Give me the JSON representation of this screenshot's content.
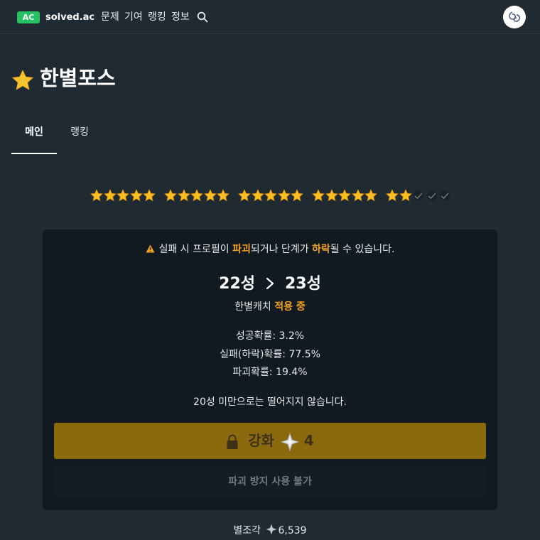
{
  "nav": {
    "badge": "AC",
    "brand": "solved.ac",
    "items": [
      "문제",
      "기여",
      "랭킹",
      "정보"
    ]
  },
  "page": {
    "title": "한별포스"
  },
  "tabs": [
    "메인",
    "랭킹"
  ],
  "stars": {
    "groups": 5,
    "per_group": 5,
    "filled": 22,
    "total": 25,
    "color": "#fbbf24"
  },
  "card": {
    "warning": {
      "pre": "실패 시 프로필이 ",
      "hl1": "파괴",
      "mid": "되거나 단계가 ",
      "hl2": "하락",
      "post": "될 수 있습니다."
    },
    "level_from": "22성",
    "level_to": "23성",
    "catch_label": "한별캐치 ",
    "catch_status": "적용 중",
    "probabilities": [
      "성공확률: 3.2%",
      "실패(하락)확률: 77.5%",
      "파괴확률: 19.4%"
    ],
    "notice": "20성 미만으로는 떨어지지 않습니다.",
    "enhance_label": "강화",
    "enhance_cost": "4",
    "protect_label": "파괴 방지 사용 불가"
  },
  "fragments": {
    "label": "별조각",
    "value": "6,539"
  },
  "colors": {
    "accent": "#f4a11d",
    "enhance_bg": "#8b6a0e",
    "badge": "#27c266"
  }
}
